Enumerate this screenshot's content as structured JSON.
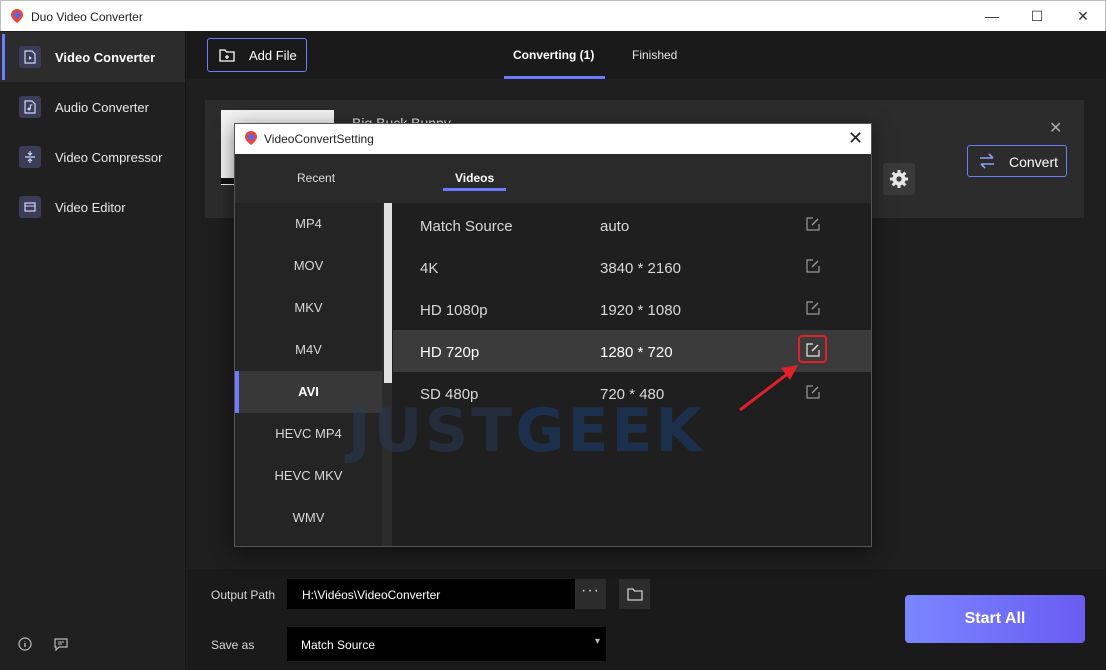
{
  "window": {
    "title": "Duo Video Converter",
    "controls": [
      "—",
      "☐",
      "✕"
    ]
  },
  "sidebar": {
    "items": [
      {
        "label": "Video Converter",
        "icon": "video-file-icon",
        "active": true
      },
      {
        "label": "Audio Converter",
        "icon": "audio-file-icon",
        "active": false
      },
      {
        "label": "Video Compressor",
        "icon": "compress-icon",
        "active": false
      },
      {
        "label": "Video Editor",
        "icon": "editor-icon",
        "active": false
      }
    ],
    "bottom_icons": [
      "info-icon",
      "feedback-icon"
    ]
  },
  "topbar": {
    "add_file_label": "Add File",
    "tabs": [
      {
        "label": "Converting (1)",
        "active": true
      },
      {
        "label": "Finished",
        "active": false
      }
    ]
  },
  "file_card": {
    "file_name": "Big Buck Bunny",
    "convert_label": "Convert"
  },
  "bottom": {
    "output_path_label": "Output Path",
    "output_path_value": "H:\\Vidéos\\VideoConverter",
    "more_label": "···",
    "save_as_label": "Save as",
    "save_as_value": "Match Source",
    "start_all_label": "Start All"
  },
  "dialog": {
    "title": "VideoConvertSetting",
    "tabs": [
      {
        "label": "Recent",
        "active": false
      },
      {
        "label": "Videos",
        "active": true
      }
    ],
    "formats": [
      {
        "label": "MP4",
        "active": false
      },
      {
        "label": "MOV",
        "active": false
      },
      {
        "label": "MKV",
        "active": false
      },
      {
        "label": "M4V",
        "active": false
      },
      {
        "label": "AVI",
        "active": true
      },
      {
        "label": "HEVC MP4",
        "active": false
      },
      {
        "label": "HEVC MKV",
        "active": false
      },
      {
        "label": "WMV",
        "active": false
      }
    ],
    "resolutions": [
      {
        "name": "Match Source",
        "value": "auto",
        "active": false
      },
      {
        "name": "4K",
        "value": "3840 * 2160",
        "active": false
      },
      {
        "name": "HD 1080p",
        "value": "1920 * 1080",
        "active": false
      },
      {
        "name": "HD 720p",
        "value": "1280 * 720",
        "active": true
      },
      {
        "name": "SD 480p",
        "value": "720 * 480",
        "active": false
      }
    ]
  },
  "watermark": {
    "part1": "JUST",
    "part2": "GEEK"
  },
  "colors": {
    "accent": "#6b7cff",
    "annotation": "#e0202a"
  }
}
